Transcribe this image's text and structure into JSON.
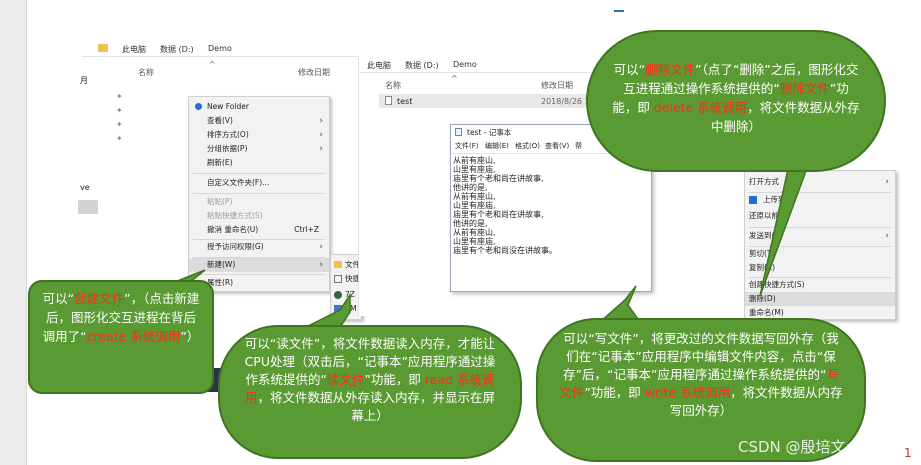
{
  "explorer_left": {
    "breadcrumb": [
      "此电脑",
      "数据 (D:)",
      "Demo"
    ],
    "col_name": "名称",
    "col_date": "修改日期",
    "sidebar_fragment_1": "月",
    "sidebar_fragment_2": "ve"
  },
  "context_menu": {
    "items": [
      {
        "label": "New Folder",
        "icon": "new-folder-icon"
      },
      {
        "label": "查看(V)",
        "arrow": true
      },
      {
        "label": "排序方式(O)",
        "arrow": true
      },
      {
        "label": "分组依据(P)",
        "arrow": true
      },
      {
        "label": "刷新(E)"
      },
      {
        "label": "自定义文件夹(F)..."
      },
      {
        "label": "粘贴(P)",
        "disabled": true
      },
      {
        "label": "粘贴快捷方式(S)",
        "disabled": true
      },
      {
        "label": "撤消 重命名(U)",
        "shortcut": "Ctrl+Z"
      },
      {
        "label": "授予访问权限(G)",
        "arrow": true
      },
      {
        "label": "新建(W)",
        "arrow": true,
        "highlight": true
      },
      {
        "label": "属性(R)"
      }
    ],
    "submenu": [
      "文件",
      "快捷",
      "7Z",
      "BM"
    ]
  },
  "explorer_mid": {
    "breadcrumb": [
      "此电脑",
      "数据 (D:)",
      "Demo"
    ],
    "col_name": "名称",
    "col_date": "修改日期",
    "file_name": "test",
    "file_date": "2018/8/26 14"
  },
  "notepad": {
    "title": "test - 记事本",
    "menu": [
      "文件(F)",
      "编辑(E)",
      "格式(O)",
      "查看(V)",
      "帮"
    ],
    "lines": [
      "从前有座山,",
      "山里有座庙,",
      "庙里有个老和尚在讲故事,",
      "他讲的是,",
      "从前有座山,",
      "山里有座庙,",
      "庙里有个老和尚在讲故事,",
      "他讲的是,",
      "从前有座山,",
      "山里有座庙,",
      "庙里有个老和尚没在讲故事。"
    ]
  },
  "right_menu": {
    "items": [
      {
        "label": "打开方式",
        "arrow": true
      },
      {
        "label": "上传到W",
        "icon": true
      },
      {
        "label": "还原以前"
      },
      {
        "label": "发送到(N",
        "arrow": true
      },
      {
        "label": "剪切(T)"
      },
      {
        "label": "复制(C)"
      },
      {
        "label": "创建快捷方式(S)"
      },
      {
        "label": "删除(D)",
        "highlight": true
      },
      {
        "label": "重命名(M)"
      }
    ]
  },
  "bubbles": {
    "create": [
      "可以“",
      "创建文件",
      "”，（点击新建后，图形化交互进程在背后调用了“",
      "create 系统调",
      "用",
      "”）"
    ],
    "read": [
      "可以“读文件”，将文件数据读入内存，才能让CPU处理（双击后，“记事本”应用程序通过操作系统提供的“",
      "读文件",
      "”功能，即 ",
      "read 系统调用",
      "，将文件数据从外存读入内存，并显示在屏幕上）"
    ],
    "write": [
      "可以“写文件”，将更改过的文件数据写回外存（我们在“记事本”应用程序中编辑文件内容，点击“保存”后，“记事本”应用程序通过操作系统提供的“",
      "写文件",
      "”功能，即 ",
      "write 系统调用",
      "，将文件数据从内存写回外存）"
    ],
    "delete": [
      "可以“",
      "删除文件",
      "”（点了“删除”之后，图形化交互进程通过操作系统提供的“",
      "删除文件",
      "”功能，即 ",
      "delete 系统调用",
      "，将文件数据从外存中删除）"
    ]
  },
  "watermark": "CSDN @殷培文enen",
  "page_number": "1"
}
